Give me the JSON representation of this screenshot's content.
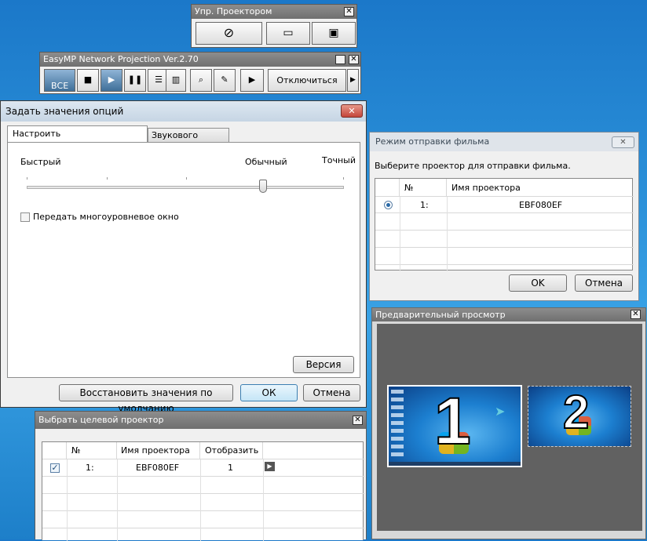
{
  "projector_control": {
    "title": "Упр. Проектором"
  },
  "easymp": {
    "title": "EasyMP Network Projection Ver.2.70",
    "all_label": "ВСЕ",
    "disconnect_label": "Отключиться"
  },
  "options": {
    "title": "Задать значения опций",
    "tabs": [
      "Настроить производительность",
      "Звукового выхода"
    ],
    "slider": {
      "label_fast": "Быстрый",
      "label_normal": "Обычный",
      "label_precise": "Точный",
      "value": 0.75
    },
    "multilayer_label": "Передать многоуровневое окно",
    "version_label": "Версия",
    "restore_label": "Восстановить значения по умолчанию",
    "ok_label": "ОК",
    "cancel_label": "Отмена"
  },
  "movie": {
    "title": "Режим отправки фильма",
    "prompt": "Выберите проектор для отправки фильма.",
    "col_num": "№",
    "col_name": "Имя проектора",
    "rows": [
      {
        "num": "1:",
        "name": "EBF080EF"
      }
    ],
    "ok_label": "OK",
    "cancel_label": "Отмена"
  },
  "preview": {
    "title": "Предварительный просмотр",
    "screen1": "1",
    "screen2": "2"
  },
  "target": {
    "title": "Выбрать целевой проектор",
    "col_num": "№",
    "col_name": "Имя проектора",
    "col_display": "Отобразить",
    "rows": [
      {
        "num": "1:",
        "name": "EBF080EF",
        "display": "1"
      }
    ]
  }
}
